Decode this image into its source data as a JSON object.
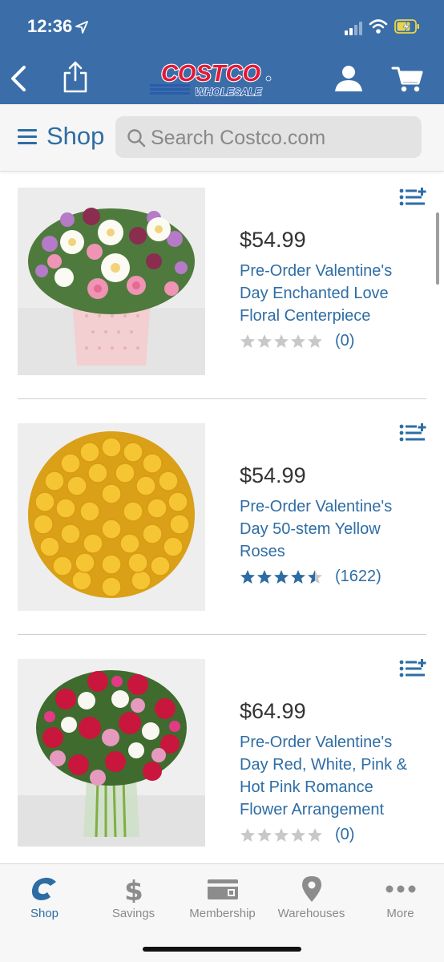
{
  "status_bar": {
    "time": "12:36"
  },
  "header": {
    "logo_alt": "Costco Wholesale"
  },
  "search": {
    "shop_label": "Shop",
    "placeholder": "Search Costco.com"
  },
  "products": [
    {
      "price": "$54.99",
      "name": "Pre-Order Valentine's Day Enchanted Love Floral Centerpiece",
      "rating_stars": 0,
      "review_count": "(0)"
    },
    {
      "price": "$54.99",
      "name": "Pre-Order Valentine's Day 50-stem Yellow Roses",
      "rating_stars": 4.5,
      "review_count": "(1622)"
    },
    {
      "price": "$64.99",
      "name": "Pre-Order Valentine's Day Red, White, Pink & Hot Pink Romance Flower Arrangement",
      "rating_stars": 0,
      "review_count": "(0)"
    }
  ],
  "tabs": [
    {
      "label": "Shop",
      "icon": "costco-c-icon",
      "active": true
    },
    {
      "label": "Savings",
      "icon": "dollar-icon",
      "active": false
    },
    {
      "label": "Membership",
      "icon": "membership-card-icon",
      "active": false
    },
    {
      "label": "Warehouses",
      "icon": "location-pin-icon",
      "active": false
    },
    {
      "label": "More",
      "icon": "more-dots-icon",
      "active": false
    }
  ],
  "colors": {
    "brand_blue": "#3b6ea8",
    "link_blue": "#2e6da4",
    "logo_red": "#e31837",
    "star_filled": "#2e6da4",
    "star_empty": "#c8c8c8"
  }
}
